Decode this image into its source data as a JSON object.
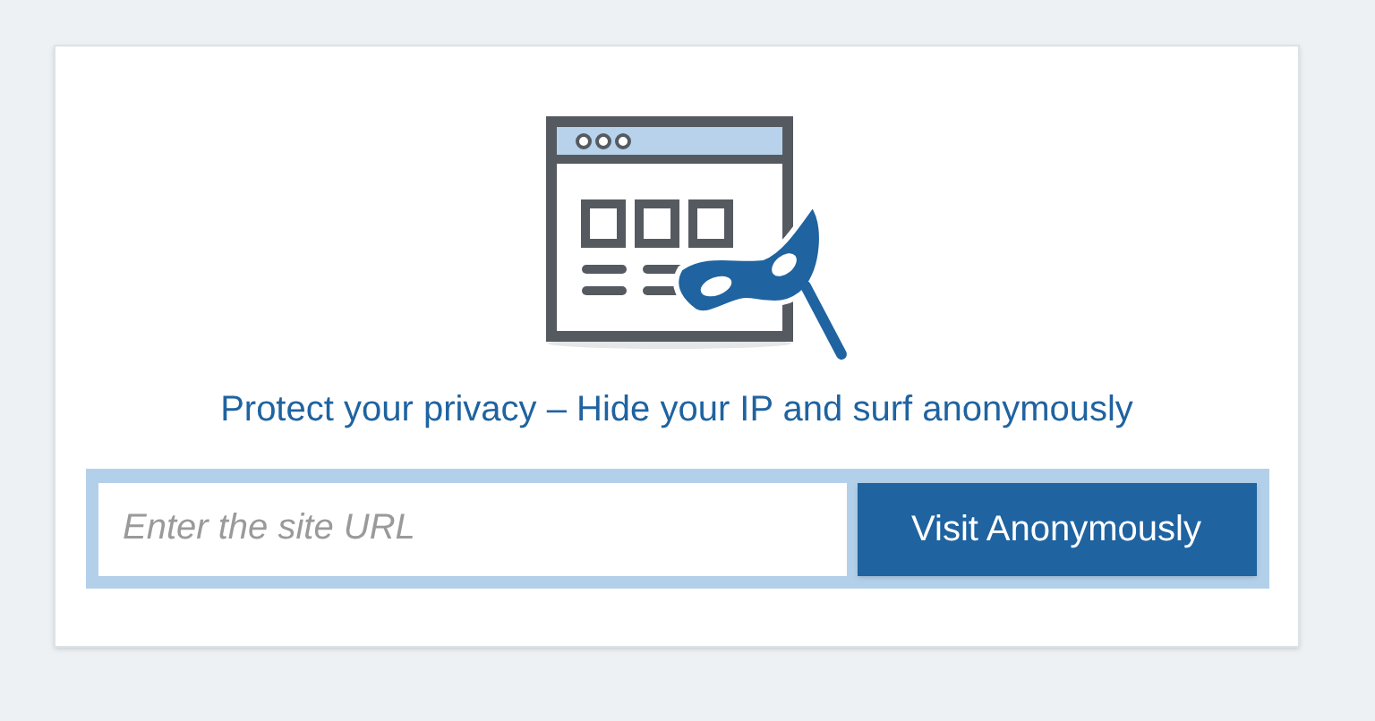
{
  "tagline": "Protect your privacy – Hide your IP and surf anonymously",
  "url_field": {
    "placeholder": "Enter the site URL"
  },
  "submit_button": "Visit Anonymously"
}
